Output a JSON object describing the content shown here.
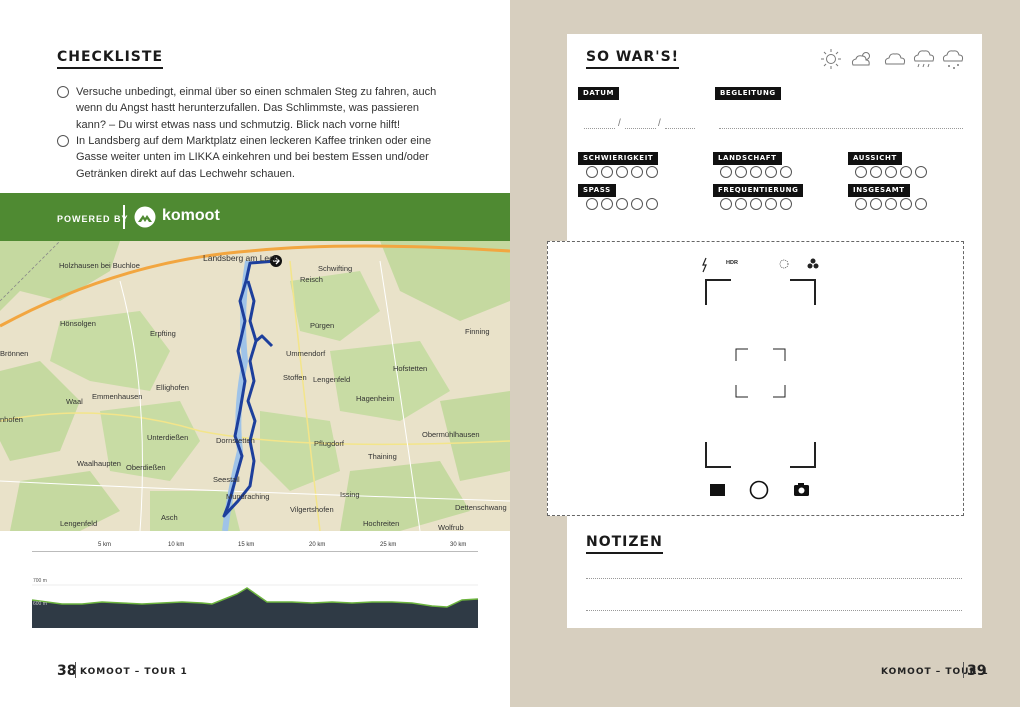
{
  "left": {
    "checklist_title": "CHECKLISTE",
    "items": [
      "Versuche unbedingt, einmal über so einen schmalen Steg zu fahren, auch wenn du Angst hastt herunterzufallen. Das Schlimmste, was passieren kann? – Du wirst etwas nass und schmutzig. Blick nach vorne hilft!",
      "In Landsberg auf dem Marktplatz einen leckeren Kaffee trinken oder eine Gasse weiter unten im LIKKA einkehren und bei bestem Essen und/oder Getränken direkt auf das Lechwehr schauen."
    ],
    "powered_by": "POWERED BY",
    "brand": "komoot",
    "brand_color": "#4f8a32",
    "map_labels": [
      "Landsberg am Lech",
      "Holzhausen bei Buchloe",
      "Schwifting",
      "Reisch",
      "Hönsolgen",
      "Erpfting",
      "Pürgen",
      "Finning",
      "Brönnen",
      "Ummendorf",
      "Ellighofen",
      "Stoffen",
      "Lengenfeld",
      "Hofstetten",
      "Emmenhausen",
      "Waal",
      "Hagenheim",
      "nhofen",
      "Unterdießen",
      "Dornstetten",
      "Obermühlhausen",
      "Waalhaupten",
      "Oberdießen",
      "Pflugdorf",
      "Thaining",
      "Seestall",
      "Mundraching",
      "Issing",
      "Asch",
      "Vilgertshofen",
      "Hochreiten",
      "Lengenfeld",
      "Dettenschwang",
      "Wolfratshausen",
      "Wolfrub"
    ],
    "km_ticks": [
      "5 km",
      "10 km",
      "15 km",
      "20 km",
      "25 km",
      "30 km"
    ],
    "elev_labels": [
      "700 m",
      "600 m"
    ],
    "page_number": "38",
    "page_label": "KOMOOT – TOUR 1"
  },
  "right": {
    "title": "SO WAR'S!",
    "datum": "DATUM",
    "begleitung": "BEGLEITUNG",
    "schwierigkeit": "SCHWIERIGKEIT",
    "landschaft": "LANDSCHAFT",
    "aussicht": "AUSSICHT",
    "spass": "SPASS",
    "frequentierung": "FREQUENTIERUNG",
    "insgesamt": "INSGESAMT",
    "date_sep": "/",
    "hdr": "HDR",
    "notizen": "NOTIZEN",
    "page_number": "39",
    "page_label": "KOMOOT – TOUR 1",
    "bg_color": "#d7cfbf"
  }
}
